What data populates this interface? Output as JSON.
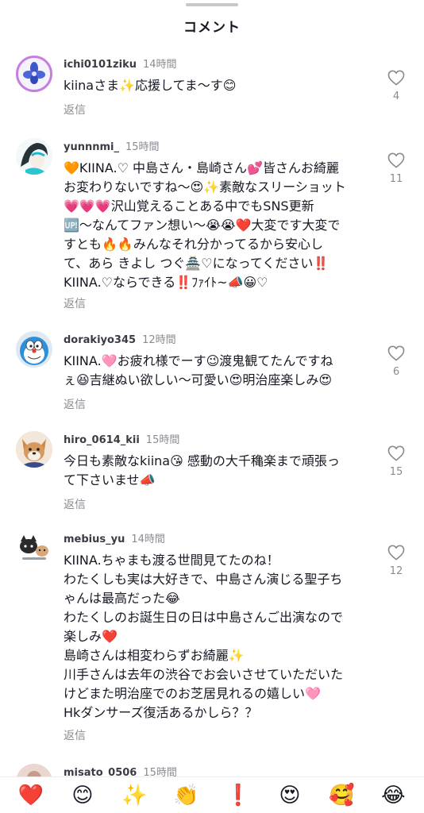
{
  "header": {
    "title": "コメント"
  },
  "comments": [
    {
      "username": "ichi0101ziku",
      "time": "14時間",
      "text": "kiinaさま✨応援してま〜す😊",
      "reply_label": "返信",
      "likes": "4"
    },
    {
      "username": "yunnnmi_",
      "time": "15時間",
      "text": "🧡KIINA.♡ 中島さん・島崎さん💕皆さんお綺麗\nお変わりないですね〜😍✨素敵なスリーショット\n💗💗💗沢山覚えることある中でもSNS更新\n🆙〜なんてファン想い〜😭😭❤️大変です大変で\nすとも🔥🔥みんなそれ分かってるから安心し\nて、あら きよし つぐ🏯♡になってください‼️\nKIINA.♡ならできる‼️ﾌｧｲﾄ~📣😀♡",
      "reply_label": "返信",
      "likes": "11"
    },
    {
      "username": "dorakiyo345",
      "time": "12時間",
      "text": "KIINA.🩷お疲れ様でーす😉渡鬼観てたんですね\nぇ😆吉継ぬい欲しい〜可愛い😍明治座楽しみ😍",
      "reply_label": "返信",
      "likes": "6"
    },
    {
      "username": "hiro_0614_kii",
      "time": "15時間",
      "text": "今日も素敵なkiina😘 感動の大千穐楽まで頑張っ\nて下さいませ📣",
      "reply_label": "返信",
      "likes": "15"
    },
    {
      "username": "mebius_yu",
      "time": "14時間",
      "text": "KIINA.ちゃまも渡る世間見てたのね！\nわたくしも実は大好きで、中島さん演じる聖子ち\nゃんは最高だった😂\nわたくしのお誕生日の日は中島さんご出演なので\n楽しみ❤️\n島崎さんは相変わらずお綺麗✨\n川手さんは去年の渋谷でお会いさせていただいた\nけどまた明治座でのお芝居見れるの嬉しい🩷\nHkダンサーズ復活あるかしら？？",
      "reply_label": "返信",
      "likes": "12"
    },
    {
      "username": "misato_0506",
      "time": "15時間"
    }
  ],
  "emoji_bar": [
    {
      "emoji": "❤️",
      "name": "heart"
    },
    {
      "emoji": "😊",
      "name": "smiling-face"
    },
    {
      "emoji": "✨",
      "name": "sparkles"
    },
    {
      "emoji": "👏",
      "name": "clapping"
    },
    {
      "emoji": "❗",
      "name": "exclamation"
    },
    {
      "emoji": "😍",
      "name": "heart-eyes"
    },
    {
      "emoji": "🥰",
      "name": "smiling-hearts"
    },
    {
      "emoji": "😂",
      "name": "tears-of-joy"
    }
  ]
}
